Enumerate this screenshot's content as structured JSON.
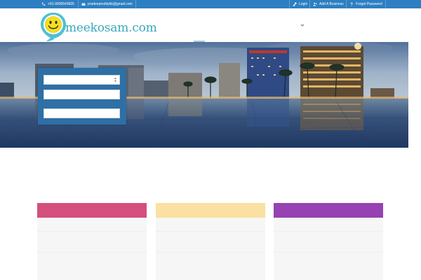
{
  "topbar": {
    "background": "#2d7fc1",
    "phone": {
      "icon": "phone-icon",
      "text": "+91-9000543605"
    },
    "email": {
      "icon": "envelope-icon",
      "text": "pradeepreddykk@gmail.com"
    },
    "login": {
      "icon": "key-icon",
      "text": "Login"
    },
    "add_business": {
      "icon": "user-plus-icon",
      "text": "Add A Business"
    },
    "forgot_password": {
      "icon": "question-icon",
      "text": "Forgot Password"
    }
  },
  "header": {
    "logo_text": "meekosam.com",
    "logo_color": "#3aa7c0",
    "logo_icon": "smiley-pin-icon",
    "nav_dropdown_icon": "chevron-down-icon"
  },
  "hero": {
    "image": "city-skyline-night-waterfront",
    "search_panel": {
      "background": "#2e6fa6",
      "select_value": "",
      "input_1_value": "",
      "input_2_value": ""
    }
  },
  "cards": [
    {
      "header_color": "#d44f7d"
    },
    {
      "header_color": "#fae0a1"
    },
    {
      "header_color": "#9642b3"
    }
  ]
}
